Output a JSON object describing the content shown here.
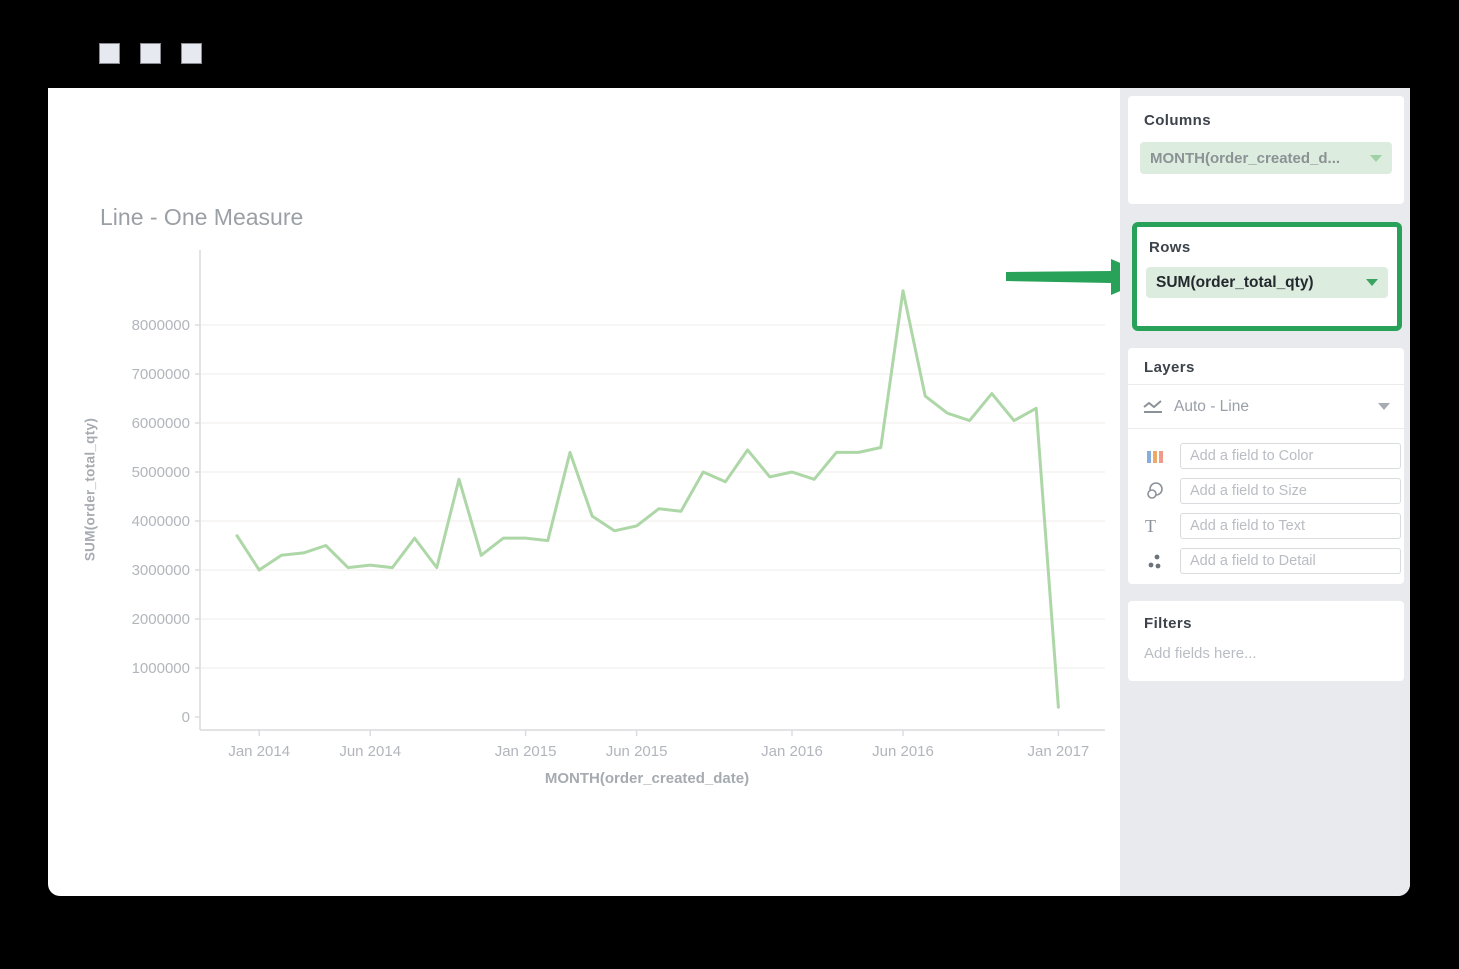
{
  "window": {
    "controls": [
      "square-1",
      "square-2",
      "square-3"
    ]
  },
  "sidebar": {
    "columns": {
      "title": "Columns",
      "pill_label": "MONTH(order_created_d..."
    },
    "rows": {
      "title": "Rows",
      "pill_label": "SUM(order_total_qty)"
    },
    "layers": {
      "title": "Layers",
      "layer_type_label": "Auto - Line",
      "fields": [
        {
          "icon": "color-bars-icon",
          "placeholder": "Add a field to Color"
        },
        {
          "icon": "size-circles-icon",
          "placeholder": "Add a field to Size"
        },
        {
          "icon": "text-icon",
          "placeholder": "Add a field to Text"
        },
        {
          "icon": "detail-dots-icon",
          "placeholder": "Add a field to Detail"
        }
      ]
    },
    "filters": {
      "title": "Filters",
      "placeholder": "Add fields here..."
    }
  },
  "colors": {
    "accent_green": "#27a258",
    "pill_background": "#dcecde",
    "line_green": "#aed7a8",
    "sidebar_background": "#e9eaee"
  },
  "chart_data": {
    "type": "line",
    "title": "Line - One Measure",
    "xlabel": "MONTH(order_created_date)",
    "ylabel": "SUM(order_total_qty)",
    "ylim": [
      0,
      8800000
    ],
    "grid": true,
    "legend": "none",
    "y_ticks": [
      0,
      1000000,
      2000000,
      3000000,
      4000000,
      5000000,
      6000000,
      7000000,
      8000000
    ],
    "x_tick_labels": [
      "Jan 2014",
      "Jun 2014",
      "Jan 2015",
      "Jun 2015",
      "Jan 2016",
      "Jun 2016",
      "Jan 2017"
    ],
    "x_tick_indices": [
      1,
      6,
      13,
      18,
      25,
      30,
      37
    ],
    "x": [
      "2013-12",
      "2014-01",
      "2014-02",
      "2014-03",
      "2014-04",
      "2014-05",
      "2014-06",
      "2014-07",
      "2014-08",
      "2014-09",
      "2014-10",
      "2014-11",
      "2014-12",
      "2015-01",
      "2015-02",
      "2015-03",
      "2015-04",
      "2015-05",
      "2015-06",
      "2015-07",
      "2015-08",
      "2015-09",
      "2015-10",
      "2015-11",
      "2015-12",
      "2016-01",
      "2016-02",
      "2016-03",
      "2016-04",
      "2016-05",
      "2016-06",
      "2016-07",
      "2016-08",
      "2016-09",
      "2016-10",
      "2016-11",
      "2016-12",
      "2017-01"
    ],
    "values": [
      3700000,
      3000000,
      3300000,
      3350000,
      3500000,
      3050000,
      3100000,
      3050000,
      3650000,
      3050000,
      4850000,
      3300000,
      3650000,
      3650000,
      3600000,
      5400000,
      4100000,
      3800000,
      3900000,
      4250000,
      4200000,
      5000000,
      4800000,
      5450000,
      4900000,
      5000000,
      4850000,
      5400000,
      5400000,
      5500000,
      8700000,
      6550000,
      6200000,
      6050000,
      6600000,
      6050000,
      6300000,
      200000
    ],
    "line_color": "#aed7a8"
  }
}
